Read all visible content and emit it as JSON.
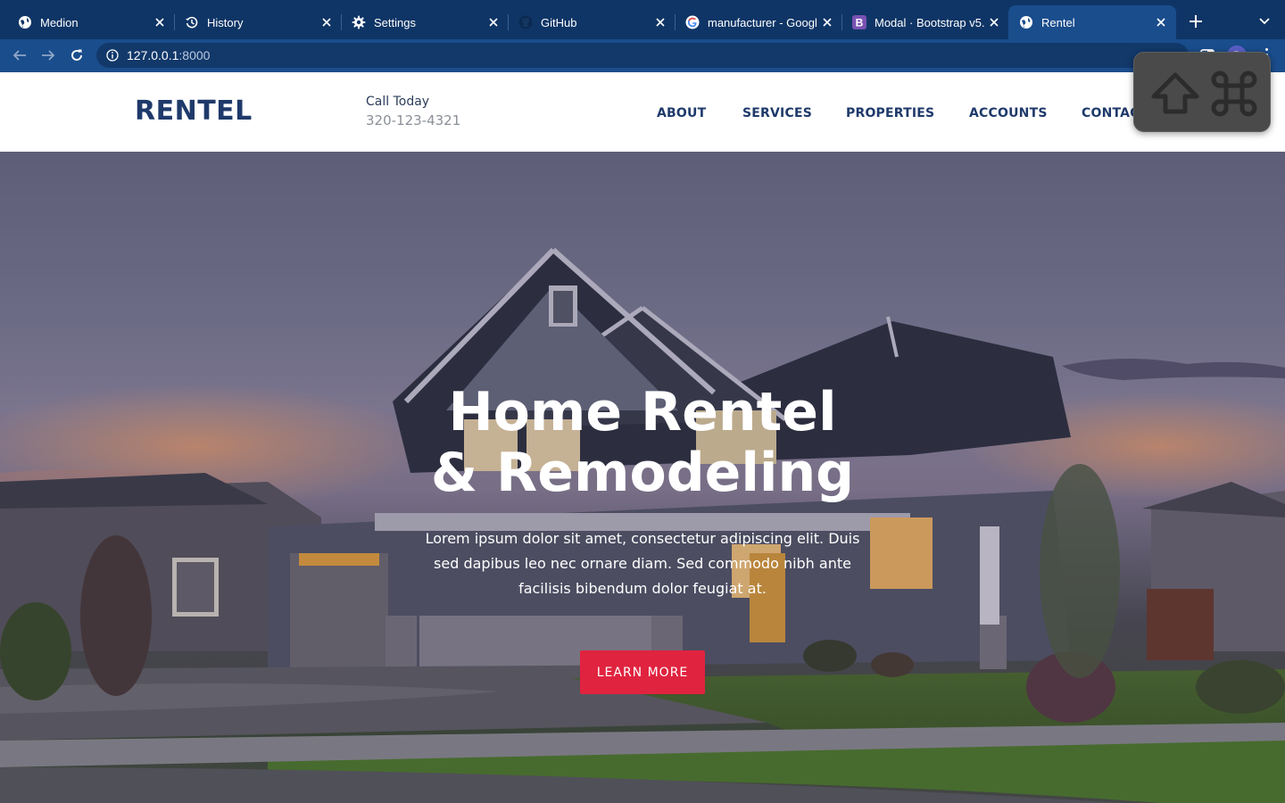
{
  "browser": {
    "tabs": [
      {
        "title": "Medion",
        "icon": "globe-icon",
        "active": false
      },
      {
        "title": "History",
        "icon": "history-icon",
        "active": false
      },
      {
        "title": "Settings",
        "icon": "gear-icon",
        "active": false
      },
      {
        "title": "GitHub",
        "icon": "github-icon",
        "active": false
      },
      {
        "title": "manufacturer - Googl",
        "icon": "google-icon",
        "active": false
      },
      {
        "title": "Modal · Bootstrap v5.",
        "icon": "bootstrap-icon",
        "active": false
      },
      {
        "title": "Rentel",
        "icon": "globe-icon",
        "active": true
      }
    ],
    "address": {
      "host": "127.0.0.1",
      "port": ":8000"
    },
    "avatar_initial": "P",
    "colors": {
      "tabbar": "#0f3566",
      "toolbar": "#1a4d8c"
    }
  },
  "site": {
    "logo": "RENTEL",
    "call_label": "Call Today",
    "phone": "320-123-4321",
    "nav": [
      "ABOUT",
      "SERVICES",
      "PROPERTIES",
      "ACCOUNTS",
      "CONTACT"
    ],
    "hero": {
      "title_line1": "Home Rentel",
      "title_line2": "& Remodeling",
      "text": "Lorem ipsum dolor sit amet, consectetur adipiscing elit. Duis sed dapibus leo nec ornare diam. Sed commodo nibh ante facilisis bibendum dolor feugiat at.",
      "button": "LEARN MORE"
    },
    "colors": {
      "brand": "#1f3a6b",
      "accent": "#e0233f"
    }
  },
  "overlay": {
    "keys": [
      "shift-key-icon",
      "command-key-icon"
    ]
  }
}
